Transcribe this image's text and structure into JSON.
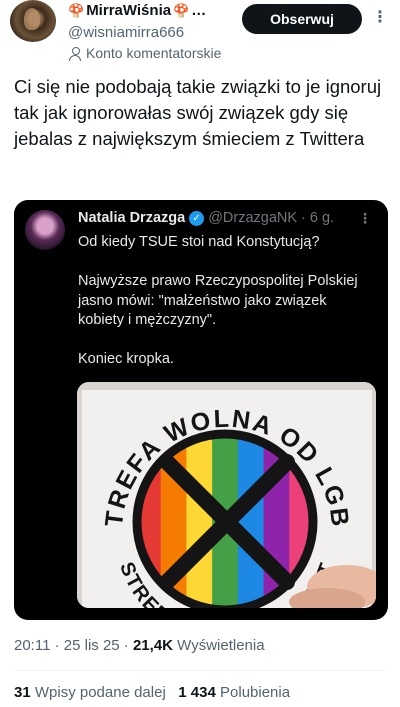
{
  "author": {
    "name": "MirraWiśnia",
    "name_suffix": "…",
    "handle": "@wisniamirra666",
    "account_type": "Konto komentatorskie"
  },
  "actions": {
    "follow_label": "Obserwuj",
    "more_icon": "more-icon"
  },
  "tweet": {
    "text": "Ci się nie podobają takie związki to je ignoruj tak jak ignorowałas swój związek gdy się jebalas z największym śmieciem z Twittera"
  },
  "quote": {
    "name": "Natalia Drzazga",
    "handle": "@DrzazgaNK",
    "time": "· 6 g.",
    "text": "Od kiedy TSUE stoi nad Konstytucją?\n\nNajwyższe prawo Rzeczypospolitej Polskiej jasno mówi: \"małżeństwo jako związek kobiety i mężczyzny\".\n\nKoniec kropka.",
    "image": {
      "sticker_text": "STREFA WOLNA OD LGBT",
      "rainbow_colors": [
        "#e53935",
        "#f57c00",
        "#fdd835",
        "#43a047",
        "#1e88e5",
        "#8e24aa",
        "#ec407a"
      ]
    }
  },
  "meta": {
    "time": "20:11 · 25 lis 25 ·",
    "views": "21,4K",
    "views_label": "Wyświetlenia"
  },
  "stats": {
    "reposts": "31",
    "reposts_label": "Wpisy podane dalej",
    "likes": "1 434",
    "likes_label": "Polubienia"
  }
}
